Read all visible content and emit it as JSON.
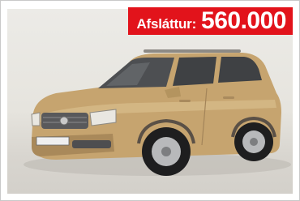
{
  "badge": {
    "label": "Afsláttur:",
    "value": "560.000",
    "color": "#e2131b"
  },
  "photo": {
    "subject": "car-photo",
    "car_color": "#c9a873",
    "plate_text": ""
  }
}
